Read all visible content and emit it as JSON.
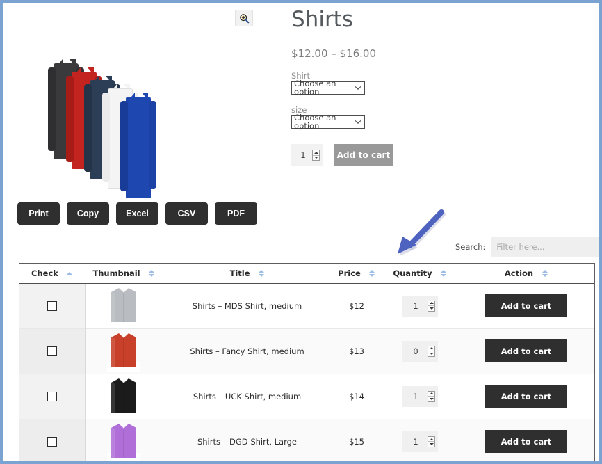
{
  "product": {
    "title": "Shirts",
    "price_range": "$12.00 – $16.00",
    "zoom_icon": "magnify-plus-icon",
    "gallery_alt": "layered-dress-shirts-photo",
    "attributes": [
      {
        "label": "Shirt",
        "value": "Choose an option",
        "icon": "chevron-down-icon"
      },
      {
        "label": "size",
        "value": "Choose an option",
        "icon": "chevron-down-icon"
      }
    ],
    "quantity": "1",
    "add_to_cart_label": "Add to cart",
    "shirt_colors": [
      "#3a3a3c",
      "#c4241f",
      "#2c3e56",
      "#f0f0f0",
      "#1f47b0"
    ]
  },
  "export_buttons": [
    {
      "label": "Print"
    },
    {
      "label": "Copy"
    },
    {
      "label": "Excel"
    },
    {
      "label": "CSV"
    },
    {
      "label": "PDF"
    }
  ],
  "search": {
    "label": "Search:",
    "placeholder": "Filter here...",
    "value": ""
  },
  "annotation": {
    "arrow_color": "#4e62c0",
    "arrow_name": "pointer-arrow-annotation"
  },
  "table": {
    "columns": [
      {
        "label": "Check",
        "sort": "asc"
      },
      {
        "label": "Thumbnail",
        "sort": "both"
      },
      {
        "label": "Title",
        "sort": "both"
      },
      {
        "label": "Price",
        "sort": "both"
      },
      {
        "label": "Quantity",
        "sort": "both"
      },
      {
        "label": "Action",
        "sort": "both"
      }
    ],
    "rows": [
      {
        "checked": false,
        "thumb_color": "#b9bcc0",
        "thumb_name": "gray-shirt-thumbnail",
        "title": "Shirts – MDS Shirt, medium",
        "price": "$12",
        "quantity": "1",
        "action_label": "Add to cart"
      },
      {
        "checked": false,
        "thumb_color": "#c8402a",
        "thumb_name": "red-floral-shirt-thumbnail",
        "title": "Shirts – Fancy Shirt, medium",
        "price": "$13",
        "quantity": "0",
        "action_label": "Add to cart"
      },
      {
        "checked": false,
        "thumb_color": "#1b1b1b",
        "thumb_name": "black-white-shirt-thumbnail",
        "title": "Shirts – UCK Shirt, medium",
        "price": "$14",
        "quantity": "1",
        "action_label": "Add to cart"
      },
      {
        "checked": false,
        "thumb_color": "#b06fd8",
        "thumb_name": "purple-shirt-thumbnail",
        "title": "Shirts – DGD Shirt, Large",
        "price": "$15",
        "quantity": "1",
        "action_label": "Add to cart"
      }
    ]
  },
  "theme": {
    "window_border": "#7ba3d1",
    "dark_button": "#2f2f2f",
    "disabled_button": "#999999",
    "sort_arrow": "#9dbde4"
  }
}
